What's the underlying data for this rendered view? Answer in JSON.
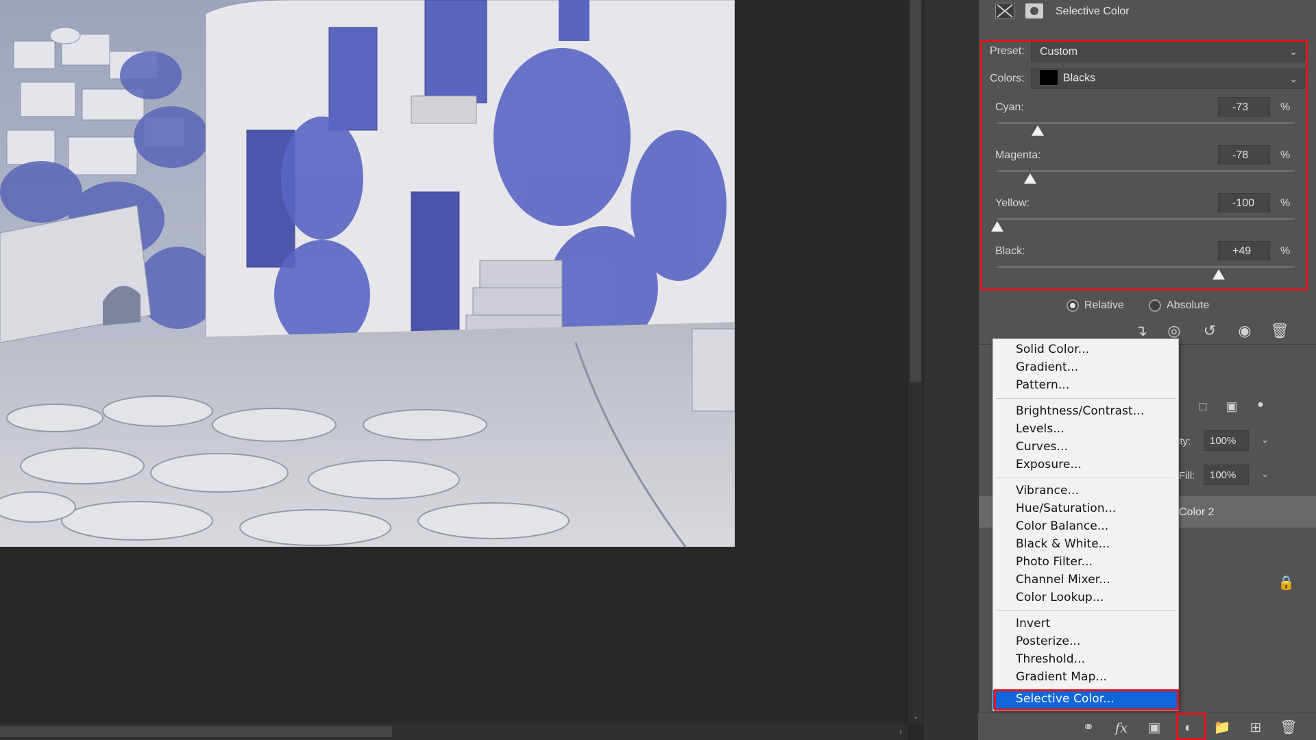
{
  "properties_panel": {
    "title": "Selective Color",
    "header_icons": [
      "adjustment-layer-icon",
      "layer-mask-icon"
    ],
    "preset": {
      "label": "Preset:",
      "value": "Custom"
    },
    "colors": {
      "label": "Colors:",
      "value": "Blacks",
      "swatch": "#000000"
    },
    "sliders": [
      {
        "label": "Cyan:",
        "value": "-73",
        "unit": "%",
        "level": -73
      },
      {
        "label": "Magenta:",
        "value": "-78",
        "unit": "%",
        "level": -78
      },
      {
        "label": "Yellow:",
        "value": "-100",
        "unit": "%",
        "level": -100
      },
      {
        "label": "Black:",
        "value": "+49",
        "unit": "%",
        "level": 49
      }
    ],
    "method": {
      "options": [
        "Relative",
        "Absolute"
      ],
      "selected": "Relative"
    },
    "toolbar_icons": [
      "clip-to-layer-icon",
      "view-previous-state-icon",
      "reset-icon",
      "visibility-eye-icon",
      "delete-icon"
    ]
  },
  "layers_panel": {
    "opacity": {
      "label": "ity:",
      "value": "100%"
    },
    "fill": {
      "label": "Fill:",
      "value": "100%"
    },
    "selected_layer_name": "Color 2",
    "bottom_icons": [
      "link-layers-icon",
      "fx-icon",
      "add-mask-icon",
      "new-adjustment-layer-icon",
      "new-group-icon",
      "new-layer-icon",
      "delete-layer-icon"
    ]
  },
  "adjustment_menu": {
    "groups": [
      [
        "Solid Color...",
        "Gradient...",
        "Pattern..."
      ],
      [
        "Brightness/Contrast...",
        "Levels...",
        "Curves...",
        "Exposure..."
      ],
      [
        "Vibrance...",
        "Hue/Saturation...",
        "Color Balance...",
        "Black & White...",
        "Photo Filter...",
        "Channel Mixer...",
        "Color Lookup..."
      ],
      [
        "Invert",
        "Posterize...",
        "Threshold...",
        "Gradient Map...",
        "Selective Color..."
      ]
    ],
    "selected_item": "Selective Color..."
  },
  "colors": {
    "highlight_red": "#e0141e",
    "menu_selection_blue": "#1066d6"
  }
}
